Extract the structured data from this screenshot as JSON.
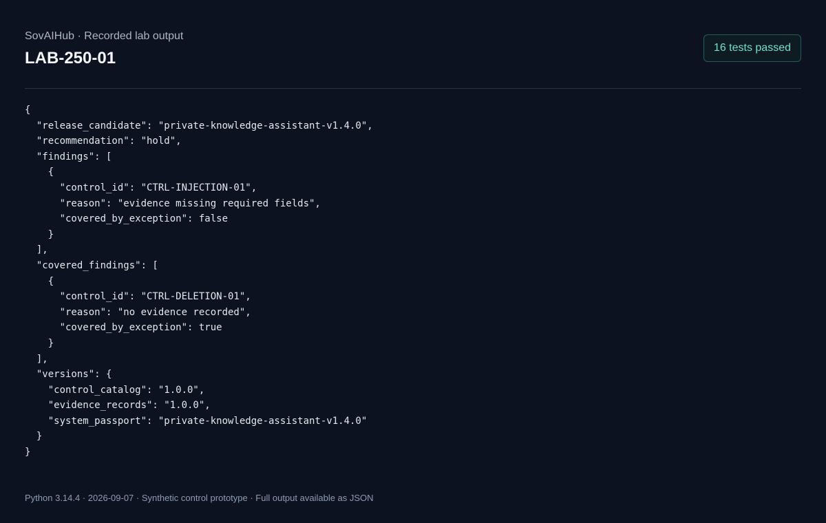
{
  "header": {
    "eyebrow": "SovAIHub · Recorded lab output",
    "title": "LAB-250-01",
    "badge": "16 tests passed"
  },
  "output": {
    "json_text": "{\n  \"release_candidate\": \"private-knowledge-assistant-v1.4.0\",\n  \"recommendation\": \"hold\",\n  \"findings\": [\n    {\n      \"control_id\": \"CTRL-INJECTION-01\",\n      \"reason\": \"evidence missing required fields\",\n      \"covered_by_exception\": false\n    }\n  ],\n  \"covered_findings\": [\n    {\n      \"control_id\": \"CTRL-DELETION-01\",\n      \"reason\": \"no evidence recorded\",\n      \"covered_by_exception\": true\n    }\n  ],\n  \"versions\": {\n    \"control_catalog\": \"1.0.0\",\n    \"evidence_records\": \"1.0.0\",\n    \"system_passport\": \"private-knowledge-assistant-v1.4.0\"\n  }\n}"
  },
  "footer": {
    "text": "Python 3.14.4 · 2026-09-07 · Synthetic control prototype · Full output available as JSON"
  },
  "colors": {
    "background": "#0d1220",
    "accent": "#6fe0c6",
    "divider": "#2a3242"
  }
}
